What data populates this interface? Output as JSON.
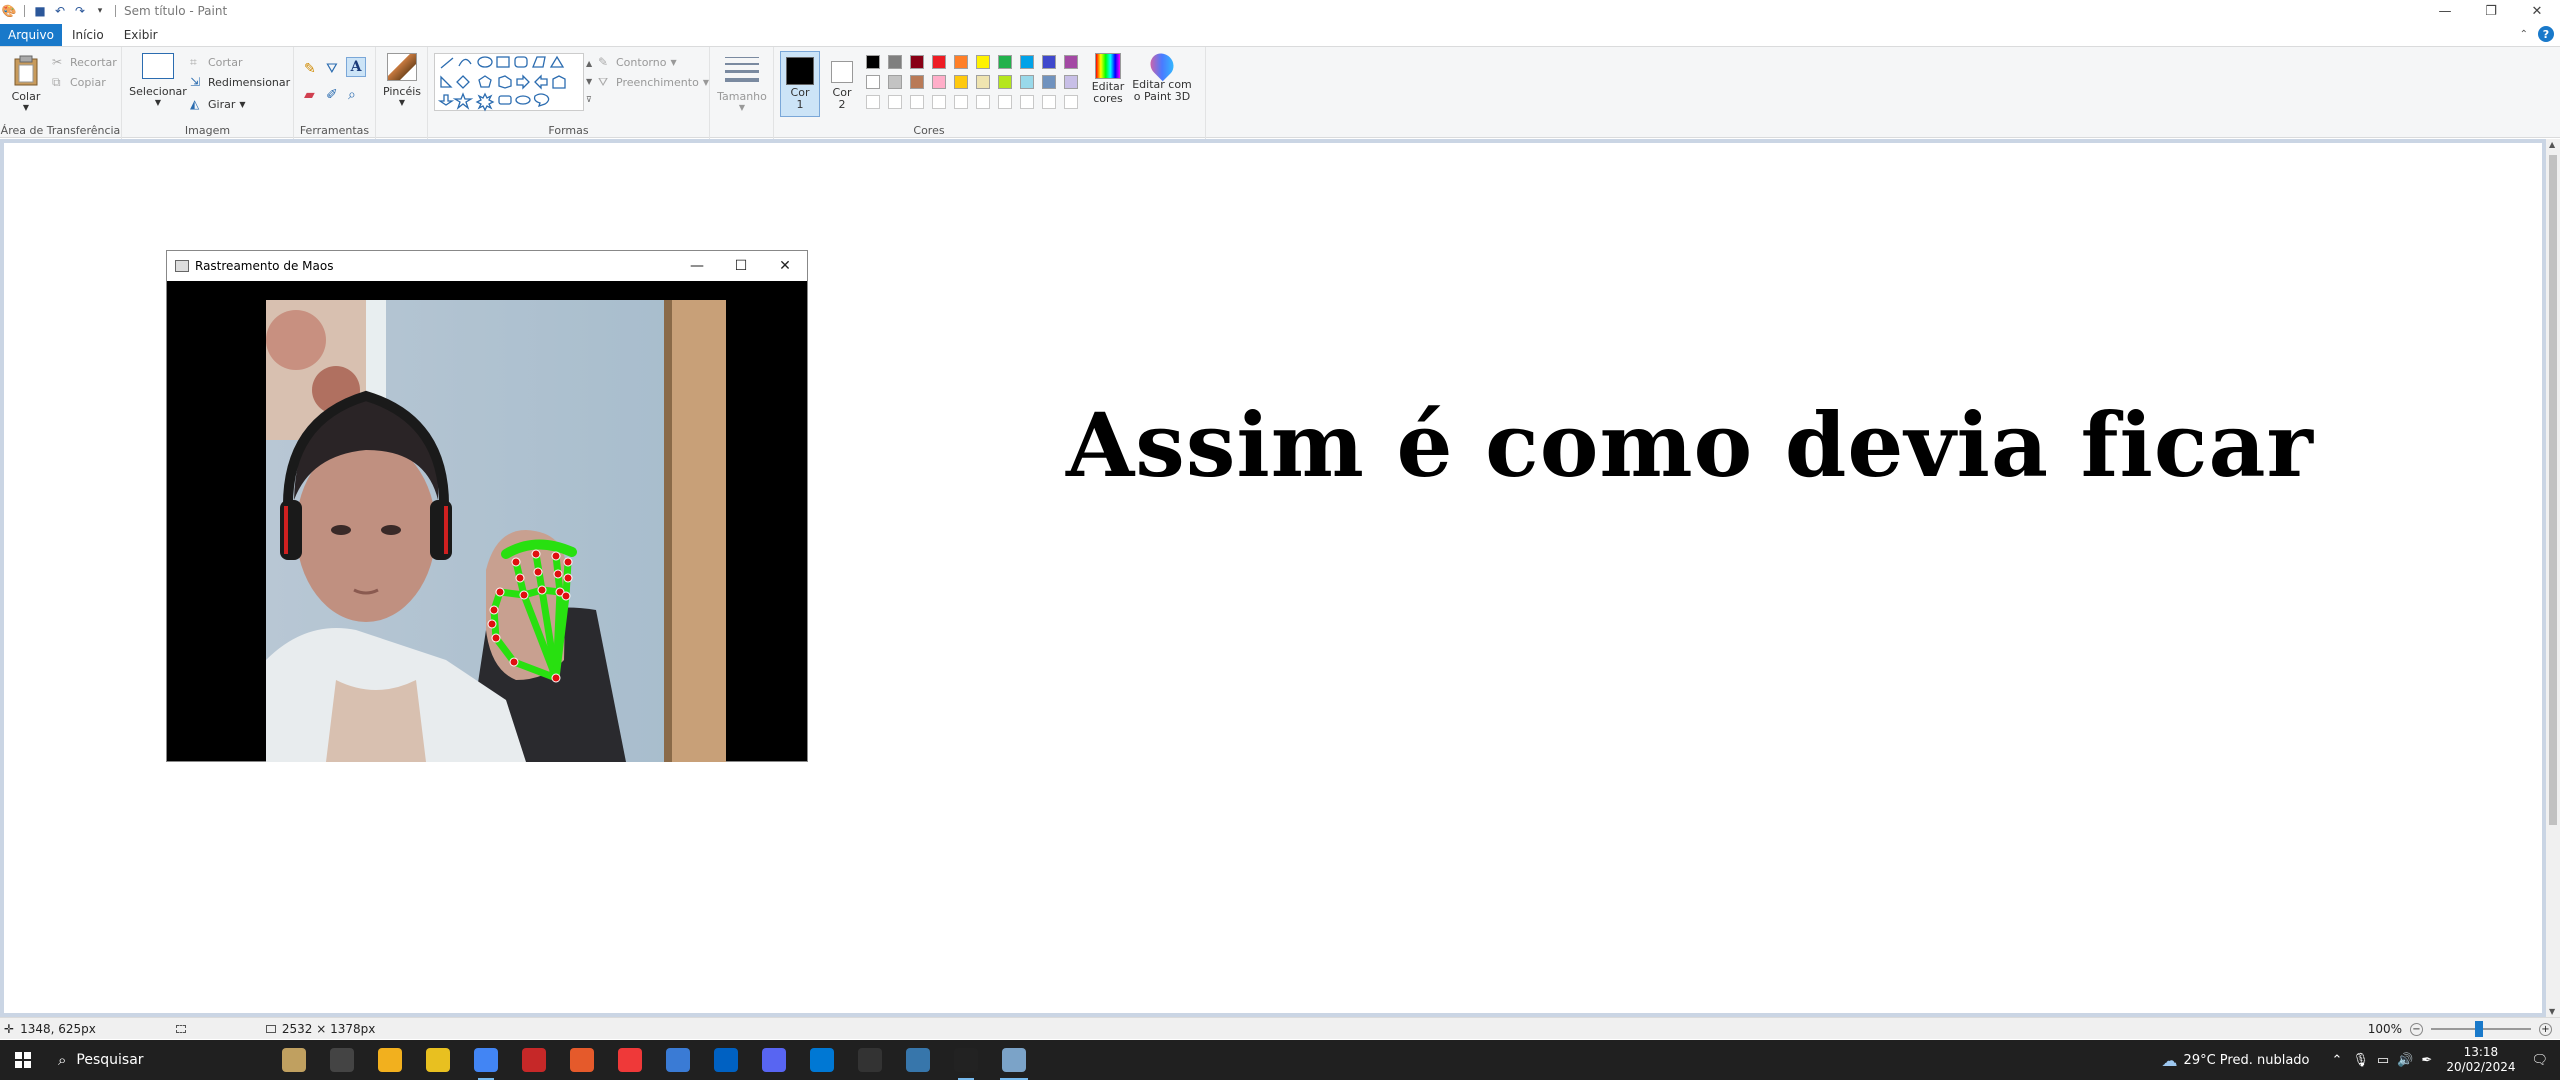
{
  "window": {
    "title": "Sem título - Paint",
    "controls": {
      "minimize": "—",
      "restore": "❐",
      "close": "✕"
    }
  },
  "tabs": [
    {
      "label": "Arquivo"
    },
    {
      "label": "Início"
    },
    {
      "label": "Exibir"
    }
  ],
  "ribbon": {
    "clipboard": {
      "paste": "Colar",
      "cut": "Recortar",
      "copy": "Copiar",
      "group": "Área de Transferência"
    },
    "image": {
      "select": "Selecionar",
      "crop": "Cortar",
      "resize": "Redimensionar",
      "rotate": "Girar",
      "group": "Imagem"
    },
    "tools": {
      "group": "Ferramentas"
    },
    "brushes": {
      "label": "Pincéis"
    },
    "shapes": {
      "outline": "Contorno",
      "fill": "Preenchimento",
      "group": "Formas"
    },
    "size": {
      "label": "Tamanho"
    },
    "colors": {
      "color1": "Cor 1",
      "color2": "Cor 2",
      "group": "Cores",
      "edit": "Editar cores",
      "paint3d": "Editar com o Paint 3D",
      "color1_value": "#000000",
      "color2_value": "#ffffff",
      "palette_row1": [
        "#000000",
        "#7f7f7f",
        "#880015",
        "#ed1c24",
        "#ff7f27",
        "#fff200",
        "#22b14c",
        "#00a2e8",
        "#3f48cc",
        "#a349a4"
      ],
      "palette_row2": [
        "#ffffff",
        "#c3c3c3",
        "#b97a57",
        "#ffaec9",
        "#ffc90e",
        "#efe4b0",
        "#b5e61d",
        "#99d9ea",
        "#7092be",
        "#c8bfe7"
      ]
    }
  },
  "camera_window": {
    "title": "Rastreamento de Maos"
  },
  "canvas_text": "Assim é como devia ficar",
  "status": {
    "cursor": "1348, 625px",
    "size": "2532 × 1378px",
    "zoom": "100%"
  },
  "taskbar": {
    "search": "Pesquisar",
    "weather": "29°C  Pred. nublado",
    "time": "13:18",
    "date": "20/02/2024",
    "apps": [
      {
        "icon": "widget-icon",
        "color": "#c0a060"
      },
      {
        "icon": "task-view-icon",
        "color": "#444"
      },
      {
        "icon": "file-explorer-icon",
        "color": "#f2b01e"
      },
      {
        "icon": "star-app-icon",
        "color": "#e8c020"
      },
      {
        "icon": "chrome-icon",
        "color": "#4285f4"
      },
      {
        "icon": "pdf-icon",
        "color": "#c62828"
      },
      {
        "icon": "browser-icon",
        "color": "#e55a2b"
      },
      {
        "icon": "vivaldi-icon",
        "color": "#ef3939"
      },
      {
        "icon": "stack-icon",
        "color": "#3a7bd5"
      },
      {
        "icon": "app-blue-icon",
        "color": "#0061c2"
      },
      {
        "icon": "discord-icon",
        "color": "#5865f2"
      },
      {
        "icon": "vscode-icon",
        "color": "#0078d4"
      },
      {
        "icon": "media-player-icon",
        "color": "#333"
      },
      {
        "icon": "python-icon",
        "color": "#3776ab"
      },
      {
        "icon": "obs-icon",
        "color": "#222"
      },
      {
        "icon": "paint-icon",
        "color": "#7ba3c8"
      }
    ]
  }
}
